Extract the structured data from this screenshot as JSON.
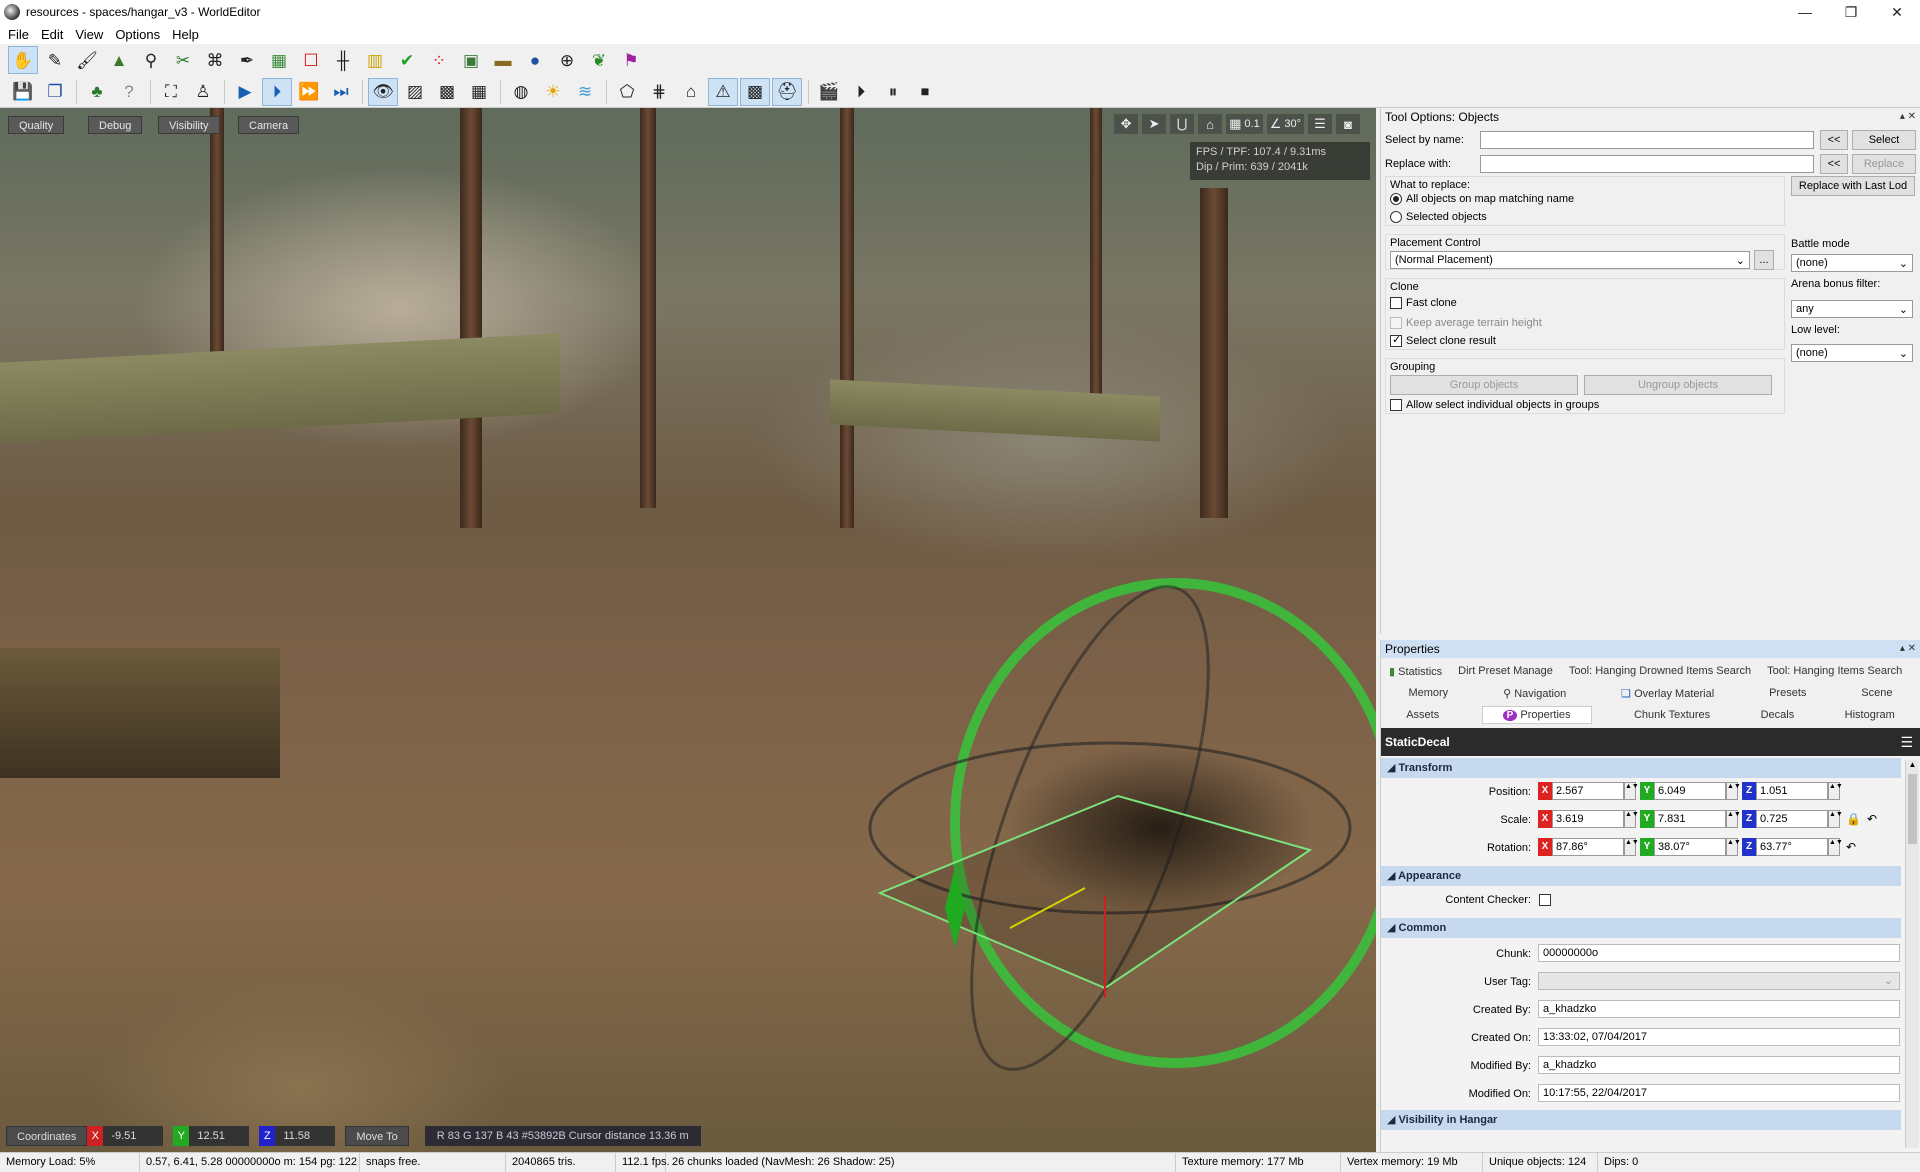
{
  "window": {
    "title": "resources - spaces/hangar_v3 - WorldEditor",
    "minimize": "—",
    "maximize": "❐",
    "close": "✕"
  },
  "menu": [
    "File",
    "Edit",
    "View",
    "Options",
    "Help"
  ],
  "toolbar1": [
    "hand-icon",
    "pen-icon",
    "brush-icon",
    "terrain-icon",
    "filter-icon",
    "scissors-icon",
    "nodes-icon",
    "eyedropper-icon",
    "image-icon",
    "rect-icon",
    "fence-icon",
    "ruler-icon",
    "check-icon",
    "dots-icon",
    "photo-icon",
    "tank-icon",
    "sphere-icon",
    "target-icon",
    "grass-icon",
    "flag-icon"
  ],
  "toolbar2": [
    "save-icon",
    "copy-icon",
    "tree-icon",
    "help-icon",
    "group-icon",
    "person-icon",
    "play-icon",
    "step-icon",
    "forward-icon",
    "fast-forward-icon",
    "eye-icon",
    "grid-icon",
    "noise-icon",
    "mesh-icon",
    "globe-icon",
    "sun-icon",
    "water-icon",
    "tag-icon",
    "wire-icon",
    "house-icon",
    "warning-icon",
    "checker-icon",
    "helmet-icon",
    "clapper-icon",
    "play-circle-icon",
    "pause-circle-icon",
    "stop-circle-icon"
  ],
  "viewport": {
    "buttons": [
      "Quality",
      "Debug",
      "Visibility",
      "Camera"
    ],
    "snap": "0.1",
    "angle": "30°",
    "fps_line1": "FPS / TPF: 107.4 / 9.31ms",
    "fps_line2": "Dip / Prim: 639 / 2041k",
    "coords_label": "Coordinates",
    "x": "-9.51",
    "y": "12.51",
    "z": "11.58",
    "moveto": "Move To",
    "rgb": "R 83   G 137   B 43   #53892B   Cursor distance 13.36 m"
  },
  "tool": {
    "title": "Tool Options: Objects",
    "select_by_name": "Select by name:",
    "replace_with": "Replace with:",
    "back": "<<",
    "select": "Select",
    "replace": "Replace",
    "replace_last_lod": "Replace with Last Lod",
    "what_to_replace": "What to replace:",
    "opt_all": "All objects on map matching name",
    "opt_selected": "Selected objects",
    "placement": "Placement Control",
    "placement_value": "(Normal Placement)",
    "more": "...",
    "battle_mode": "Battle mode",
    "battle_value": "(none)",
    "arena_filter": "Arena bonus filter:",
    "arena_value": "any",
    "low_level": "Low level:",
    "low_value": "(none)",
    "clone": "Clone",
    "fast_clone": "Fast clone",
    "keep_avg": "Keep average terrain height",
    "select_clone": "Select clone result",
    "grouping": "Grouping",
    "group_objects": "Group objects",
    "ungroup_objects": "Ungroup objects",
    "allow_select": "Allow select individual objects in groups"
  },
  "props": {
    "title": "Properties",
    "tabs1": [
      "Statistics",
      "Dirt Preset Manage",
      "Tool: Hanging Drowned Items Search",
      "Tool: Hanging Items Search"
    ],
    "tabs2": [
      "Memory",
      "Navigation",
      "Overlay Material",
      "Presets",
      "Scene"
    ],
    "tabs3": [
      "Assets",
      "Properties",
      "Chunk Textures",
      "Decals",
      "Histogram"
    ],
    "object": "StaticDecal",
    "transform": "Transform",
    "position": "Position:",
    "scale": "Scale:",
    "rotation": "Rotation:",
    "pos": [
      "2.567",
      "6.049",
      "1.051"
    ],
    "scl": [
      "3.619",
      "7.831",
      "0.725"
    ],
    "rot": [
      "87.86°",
      "38.07°",
      "63.77°"
    ],
    "appearance": "Appearance",
    "content_checker": "Content Checker:",
    "common": "Common",
    "chunk_lbl": "Chunk:",
    "chunk": "00000000o",
    "usertag_lbl": "User Tag:",
    "createdby_lbl": "Created By:",
    "createdby": "a_khadzko",
    "createdon_lbl": "Created On:",
    "createdon": "13:33:02, 07/04/2017",
    "modifiedby_lbl": "Modified By:",
    "modifiedby": "a_khadzko",
    "modifiedon_lbl": "Modified On:",
    "modifiedon": "10:17:55, 22/04/2017",
    "visibility": "Visibility in Hangar"
  },
  "status": [
    "Memory Load: 5%",
    "0.57, 6.41, 5.28 00000000o m: 154 pg: 122",
    "snaps free.",
    "2040865 tris.",
    "112.1 fps.",
    "26 chunks loaded (NavMesh: 26 Shadow: 25)",
    "Texture memory: 177 Mb",
    "Vertex memory: 19 Mb",
    "Unique objects: 124",
    "Dips: 0"
  ]
}
